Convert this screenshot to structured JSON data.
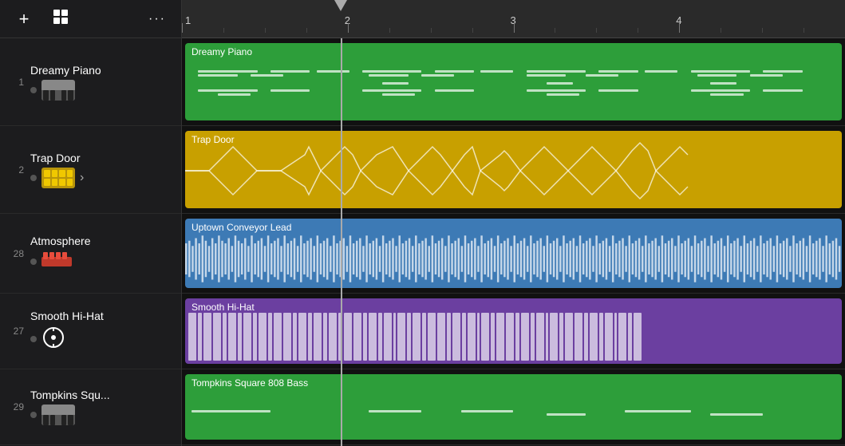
{
  "sidebar": {
    "header": {
      "add_label": "+",
      "layers_label": "⊞",
      "more_label": "···"
    },
    "tracks": [
      {
        "number": "1",
        "name": "Dreamy Piano",
        "instrument": "piano",
        "has_dot": true,
        "has_arrow": false,
        "row_class": "track-row-1"
      },
      {
        "number": "2",
        "name": "Trap Door",
        "instrument": "drum",
        "has_dot": true,
        "has_arrow": true,
        "row_class": "track-row-2"
      },
      {
        "number": "28",
        "name": "Atmosphere",
        "instrument": "synth",
        "has_dot": true,
        "has_arrow": false,
        "row_class": "track-row-3"
      },
      {
        "number": "27",
        "name": "Smooth Hi-Hat",
        "instrument": "hihat",
        "has_dot": true,
        "has_arrow": false,
        "row_class": "track-row-4"
      },
      {
        "number": "29",
        "name": "Tompkins Squ...",
        "instrument": "bass",
        "has_dot": true,
        "has_arrow": false,
        "row_class": "track-row-5"
      }
    ]
  },
  "ruler": {
    "markers": [
      "1",
      "2",
      "3",
      "4"
    ]
  },
  "clips": [
    {
      "id": "dreamy-piano",
      "label": "Dreamy Piano",
      "type": "midi",
      "color": "green"
    },
    {
      "id": "trap-door",
      "label": "Trap Door",
      "type": "audio",
      "color": "yellow"
    },
    {
      "id": "atmosphere",
      "label": "Uptown Conveyor Lead",
      "type": "audio",
      "color": "blue"
    },
    {
      "id": "smooth-hihat",
      "label": "Smooth Hi-Hat",
      "type": "beats",
      "color": "purple"
    },
    {
      "id": "tompkins",
      "label": "Tompkins Square 808 Bass",
      "type": "midi",
      "color": "green"
    }
  ],
  "playhead_position_pct": "24"
}
